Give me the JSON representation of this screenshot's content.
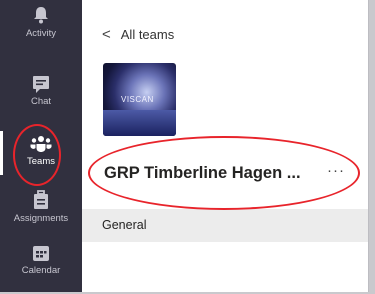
{
  "nav": {
    "items": [
      {
        "label": "Activity",
        "icon": "bell-icon"
      },
      {
        "label": "Chat",
        "icon": "chat-icon"
      },
      {
        "label": "Teams",
        "icon": "teams-icon"
      },
      {
        "label": "Assignments",
        "icon": "assignments-icon"
      },
      {
        "label": "Calendar",
        "icon": "calendar-icon"
      }
    ],
    "active": "Teams"
  },
  "panel": {
    "back_label": "All teams",
    "team_image_text": "VISCAN",
    "team_name": "GRP Timberline Hagen ...",
    "more_label": "···",
    "channel": "General"
  },
  "colors": {
    "rail_bg": "#31303f",
    "annotation_red": "#e8242b",
    "channel_bg": "#ececec"
  }
}
